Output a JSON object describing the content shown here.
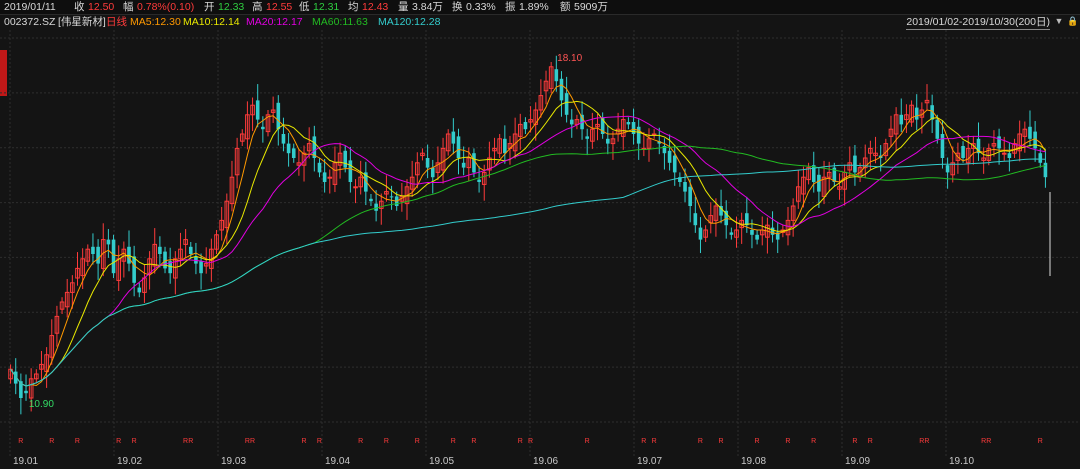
{
  "quote": {
    "date": "2019/01/11",
    "close_label": "收",
    "close": "12.50",
    "change_label": "幅",
    "change": "0.78%(0.10)",
    "open_label": "开",
    "open": "12.33",
    "high_label": "高",
    "high": "12.55",
    "low_label": "低",
    "low": "12.31",
    "avg_label": "均",
    "avg": "12.43",
    "volume_label": "量",
    "volume": "3.84万",
    "turnover_label": "换",
    "turnover": "0.33%",
    "amplitude_label": "振",
    "amplitude": "1.89%",
    "amount_label": "额",
    "amount": "5909万"
  },
  "stock": {
    "code": "002372.SZ",
    "name": "[伟星新材]",
    "period": "日线"
  },
  "ma": [
    {
      "label": "MA5:12.30",
      "color": "#ff9900"
    },
    {
      "label": "MA10:12.14",
      "color": "#e8e800"
    },
    {
      "label": "MA20:12.17",
      "color": "#e000e0"
    },
    {
      "label": "MA60:11.63",
      "color": "#22bb22"
    },
    {
      "label": "MA120:12.28",
      "color": "#33cccc"
    }
  ],
  "range": "2019/01/02-2019/10/30(200日)",
  "controls": {
    "down": "▼",
    "lock": "🔒"
  },
  "colors": {
    "up": "#ff3b3b",
    "down": "#33cccc",
    "grid": "#2e2e2e",
    "bg": "#141414"
  },
  "annotations": {
    "high": "18.10",
    "low": "10.90"
  },
  "chart_data": {
    "type": "candlestick",
    "x_ticks": [
      "19.01",
      "19.02",
      "19.03",
      "19.04",
      "19.05",
      "19.06",
      "19.07",
      "19.08",
      "19.09",
      "19.10"
    ],
    "ylim": [
      10.5,
      18.5
    ],
    "high_marker": 18.1,
    "low_marker": 10.9,
    "close_series": [
      11.6,
      11.3,
      11.0,
      11.1,
      11.4,
      11.5,
      11.7,
      11.9,
      12.3,
      12.7,
      13.0,
      13.2,
      13.4,
      13.7,
      13.9,
      14.1,
      14.0,
      13.8,
      14.3,
      14.2,
      13.6,
      13.9,
      14.1,
      13.8,
      13.4,
      13.2,
      13.5,
      13.9,
      14.2,
      14.0,
      13.7,
      13.6,
      13.9,
      14.1,
      14.3,
      14.0,
      13.8,
      13.6,
      13.8,
      14.1,
      14.4,
      14.7,
      15.1,
      15.6,
      16.2,
      16.5,
      16.9,
      17.1,
      16.8,
      16.6,
      16.9,
      17.0,
      16.6,
      16.3,
      16.1,
      16.0,
      15.9,
      16.1,
      16.3,
      16.0,
      15.7,
      15.5,
      15.6,
      15.9,
      16.1,
      15.8,
      15.5,
      15.4,
      15.6,
      15.3,
      15.1,
      14.9,
      15.1,
      15.3,
      15.2,
      15.0,
      15.2,
      15.4,
      15.6,
      15.9,
      16.1,
      15.8,
      15.6,
      15.9,
      16.2,
      16.5,
      16.3,
      16.0,
      15.8,
      16.0,
      15.7,
      15.5,
      15.7,
      16.0,
      16.2,
      16.4,
      16.1,
      16.3,
      16.5,
      16.7,
      16.6,
      16.8,
      17.0,
      17.3,
      17.6,
      17.9,
      17.6,
      17.2,
      16.9,
      16.7,
      16.8,
      16.6,
      16.4,
      16.6,
      16.7,
      16.5,
      16.3,
      16.4,
      16.6,
      16.8,
      16.7,
      16.5,
      16.3,
      16.2,
      16.4,
      16.5,
      16.3,
      16.1,
      15.9,
      15.7,
      15.5,
      15.3,
      15.0,
      14.6,
      14.3,
      14.5,
      14.8,
      15.0,
      14.8,
      14.6,
      14.4,
      14.5,
      14.7,
      14.6,
      14.4,
      14.3,
      14.5,
      14.6,
      14.4,
      14.3,
      14.5,
      14.7,
      15.0,
      15.4,
      15.6,
      15.8,
      15.5,
      15.3,
      15.6,
      15.7,
      15.5,
      15.4,
      15.7,
      15.9,
      15.7,
      15.8,
      16.0,
      16.2,
      16.1,
      16.0,
      16.3,
      16.6,
      16.9,
      16.7,
      16.9,
      17.1,
      16.8,
      17.0,
      17.2,
      16.8,
      16.4,
      16.0,
      15.7,
      15.9,
      16.1,
      16.0,
      16.2,
      16.3,
      16.1,
      16.0,
      16.2,
      16.3,
      16.2,
      16.1,
      16.0,
      16.3,
      16.5,
      16.6,
      16.4,
      16.2,
      15.9,
      15.6
    ]
  }
}
